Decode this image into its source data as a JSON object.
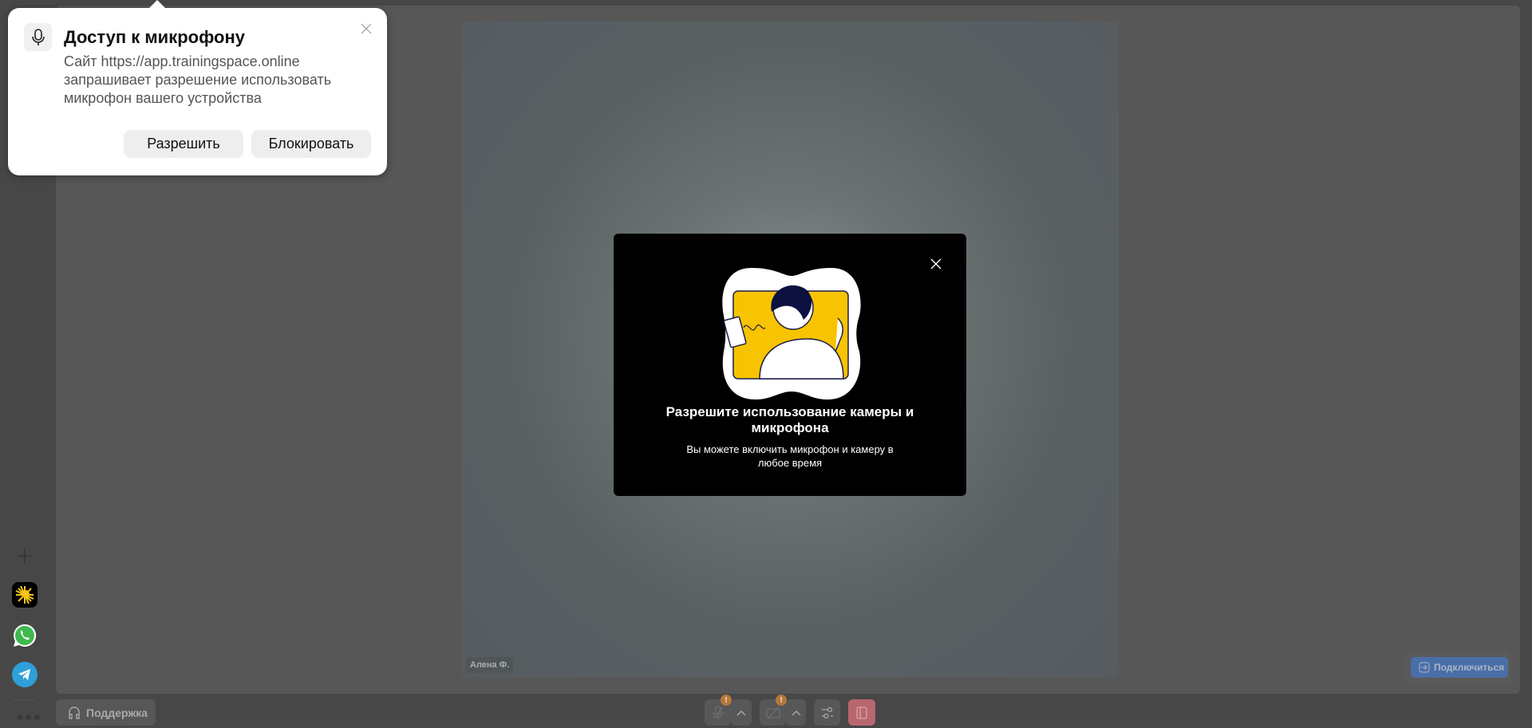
{
  "permission_popup": {
    "title": "Доступ к микрофону",
    "description": "Сайт https://app.trainingspace.online запрашивает разрешение использовать микрофон вашего устройства",
    "allow_label": "Разрешить",
    "block_label": "Блокировать"
  },
  "modal": {
    "title": "Разрешите использование камеры и микрофона",
    "subtitle": "Вы можете включить микрофон и камеру в любое время"
  },
  "tile": {
    "participant_name": "Алена Ф."
  },
  "bottom_bar": {
    "support_label": "Поддержка",
    "mic_warning": "!",
    "cam_warning": "!"
  },
  "connect_label": "Подключиться",
  "colors": {
    "accent_yellow": "#f8c300",
    "connect_blue": "#4a6fa8",
    "leave_red": "#b8676e",
    "warning": "#b5773b"
  }
}
